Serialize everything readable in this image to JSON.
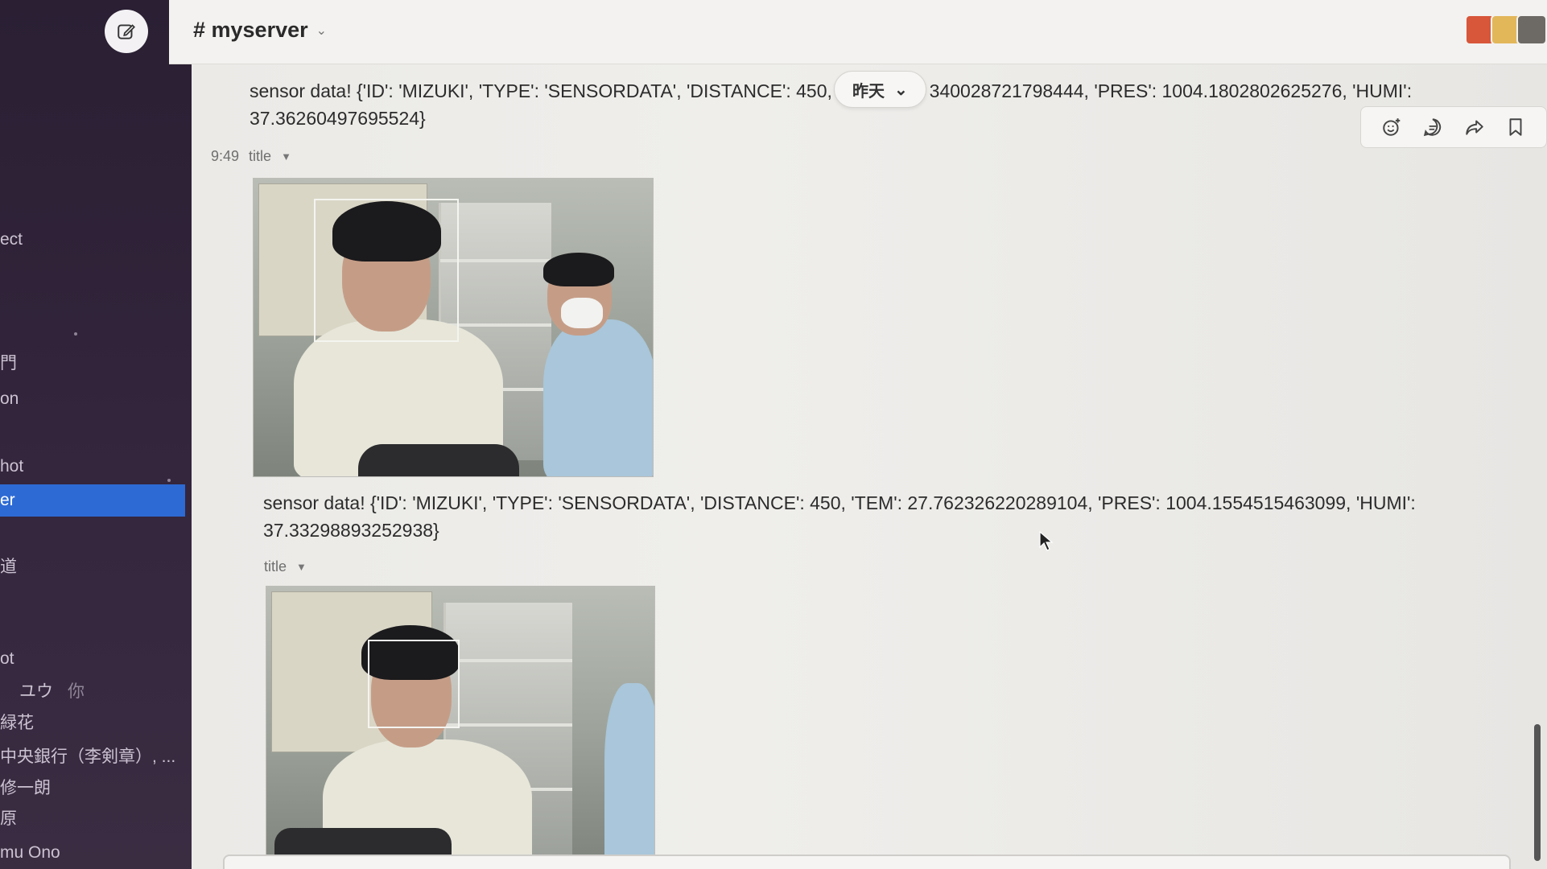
{
  "sidebar": {
    "compose_icon": "compose-icon",
    "items": [
      {
        "label": "ect",
        "sub": ""
      },
      {
        "label": "門",
        "sub": ""
      },
      {
        "label": "on",
        "sub": ""
      },
      {
        "label": "hot",
        "sub": ""
      },
      {
        "label": "er",
        "sub": ""
      },
      {
        "label": "道",
        "sub": ""
      },
      {
        "label": "ot",
        "sub": ""
      },
      {
        "label": "",
        "sub": "ユウ",
        "sub2": "你"
      },
      {
        "label": "緑花",
        "sub": ""
      },
      {
        "label": "中央銀行（李剣章）, ...",
        "sub": ""
      },
      {
        "label": "修一朗",
        "sub": ""
      },
      {
        "label": "原",
        "sub": ""
      },
      {
        "label": "mu Ono",
        "sub": ""
      }
    ]
  },
  "header": {
    "channel": "# myserver",
    "chevron": "⌄"
  },
  "date_divider": {
    "label": "昨天",
    "chevron": "⌄"
  },
  "messages": [
    {
      "text_line1_a": "sensor data! {'ID': 'MIZUKI', 'TYPE': 'SENSORDATA', 'DISTANCE': 450, '",
      "text_line1_b": "340028721798444, 'PRES': 1004.1802802625276, 'HUMI':",
      "text_line2": "37.36260497695524}",
      "time": "9:49",
      "file_title": "title"
    },
    {
      "text_line1": "sensor data! {'ID': 'MIZUKI', 'TYPE': 'SENSORDATA', 'DISTANCE': 450, 'TEM': 27.762326220289104, 'PRES': 1004.1554515463099, 'HUMI':",
      "text_line2": "37.33298893252938}",
      "file_title": "title"
    }
  ],
  "hover_actions": [
    {
      "icon": "add-reaction-icon"
    },
    {
      "icon": "reply-in-thread-icon"
    },
    {
      "icon": "share-icon"
    },
    {
      "icon": "bookmark-icon"
    }
  ],
  "colors": {
    "sidebar_bg": "#2a1f33",
    "active_item": "#2d6ad4",
    "main_bg": "#ecebe8"
  }
}
